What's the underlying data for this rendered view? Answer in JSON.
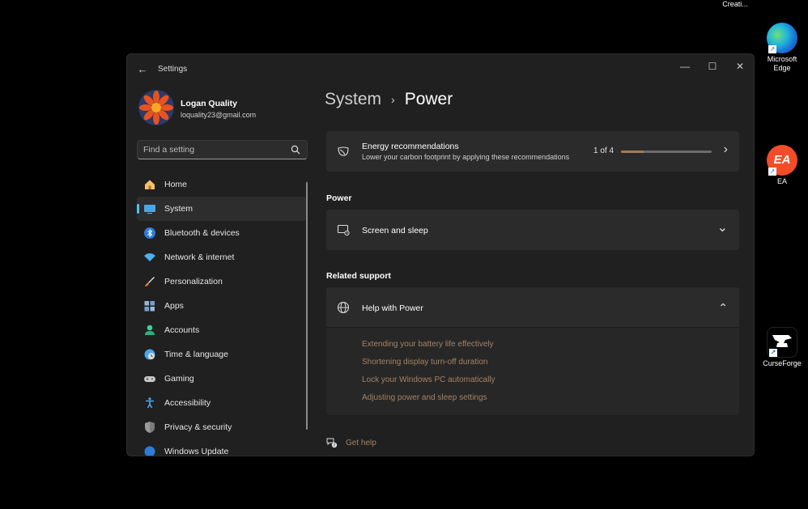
{
  "desktop": {
    "icons": [
      {
        "label": "Creati...",
        "icon": "creative-cloud-icon"
      },
      {
        "label": "Microsoft Edge",
        "icon": "edge-icon"
      },
      {
        "label": "EA",
        "icon": "ea-icon",
        "glyph": "EA"
      },
      {
        "label": "CurseForge",
        "icon": "curseforge-icon"
      }
    ]
  },
  "window": {
    "title": "Settings",
    "controls": {
      "minimize": "—",
      "maximize": "☐",
      "close": "✕"
    },
    "back_glyph": "←"
  },
  "profile": {
    "name": "Logan Quality",
    "email": "loquality23@gmail.com"
  },
  "search": {
    "placeholder": "Find a setting"
  },
  "nav": {
    "items": [
      {
        "label": "Home",
        "icon": "home-icon",
        "active": false
      },
      {
        "label": "System",
        "icon": "system-icon",
        "active": true
      },
      {
        "label": "Bluetooth & devices",
        "icon": "bluetooth-icon",
        "active": false
      },
      {
        "label": "Network & internet",
        "icon": "wifi-icon",
        "active": false
      },
      {
        "label": "Personalization",
        "icon": "brush-icon",
        "active": false
      },
      {
        "label": "Apps",
        "icon": "apps-icon",
        "active": false
      },
      {
        "label": "Accounts",
        "icon": "accounts-icon",
        "active": false
      },
      {
        "label": "Time & language",
        "icon": "clock-globe-icon",
        "active": false
      },
      {
        "label": "Gaming",
        "icon": "gamepad-icon",
        "active": false
      },
      {
        "label": "Accessibility",
        "icon": "accessibility-icon",
        "active": false
      },
      {
        "label": "Privacy & security",
        "icon": "shield-icon",
        "active": false
      },
      {
        "label": "Windows Update",
        "icon": "update-icon",
        "active": false
      }
    ]
  },
  "breadcrumb": {
    "parent": "System",
    "separator": "›",
    "current": "Power"
  },
  "energy": {
    "title": "Energy recommendations",
    "subtitle": "Lower your carbon footprint by applying these recommendations",
    "counter": "1 of 4",
    "progress": 0.25,
    "chevron": "›"
  },
  "power_section": {
    "label": "Power",
    "screen_sleep": {
      "title": "Screen and sleep",
      "chevron": "⌄"
    }
  },
  "related": {
    "label": "Related support",
    "help": {
      "title": "Help with Power",
      "chevron": "⌃",
      "links": [
        "Extending your battery life effectively",
        "Shortening display turn-off duration",
        "Lock your Windows PC automatically",
        "Adjusting power and sleep settings"
      ]
    }
  },
  "get_help": {
    "label": "Get help"
  },
  "colors": {
    "accent": "#4cc2ff",
    "link": "#a58264",
    "window_bg": "#202020",
    "card_bg": "#2b2b2b"
  }
}
